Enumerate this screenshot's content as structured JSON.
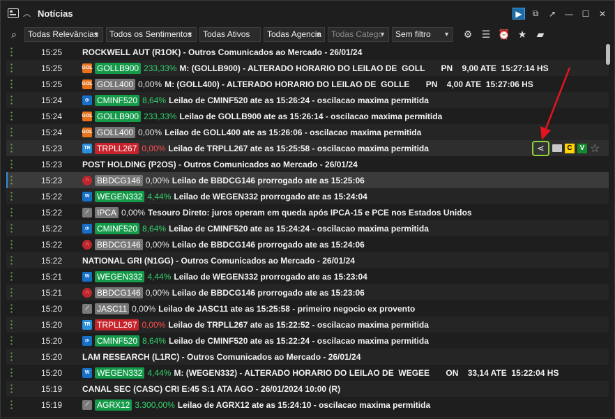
{
  "window": {
    "title": "Notícias"
  },
  "toolbar": {
    "relevance": "Todas Relevâncias",
    "sentiment": "Todos os Sentimentos",
    "assets": "Todas Ativos",
    "agency": "Todas Agencia",
    "category": "Todas Catego",
    "filter": "Sem filtro"
  },
  "row_actions": {
    "c_label": "C",
    "v_label": "V"
  },
  "rows": [
    {
      "time": "15:25",
      "text": "ROCKWELL AUT (R1OK) - Outros Comunicados ao Mercado - 26/01/24"
    },
    {
      "time": "15:25",
      "ticker": "GOLLB900",
      "pct": "233,33%",
      "text": "M: (GOLLB900) - ALTERADO HORARIO DO LEILAO DE  GOLL       PN    9,00 ATE  15:27:14 HS"
    },
    {
      "time": "15:25",
      "ticker": "GOLL400",
      "pct": "0,00%",
      "text": "M: (GOLL400) - ALTERADO HORARIO DO LEILAO DE  GOLLE       PN    4,00 ATE  15:27:06 HS"
    },
    {
      "time": "15:24",
      "ticker": "CMINF520",
      "pct": "8,64%",
      "text": "Leilao de CMINF520 ate as 15:26:24 - oscilacao maxima permitida"
    },
    {
      "time": "15:24",
      "ticker": "GOLLB900",
      "pct": "233,33%",
      "text": "Leilao de GOLLB900 ate as 15:26:14 - oscilacao maxima permitida"
    },
    {
      "time": "15:24",
      "ticker": "GOLL400",
      "pct": "0,00%",
      "text": "Leilao de GOLL400 ate as 15:26:06 - oscilacao maxima permitida"
    },
    {
      "time": "15:23",
      "ticker": "TRPLL267",
      "pct": "0,00%",
      "text": "Leilao de TRPLL267 ate as 15:25:58 - oscilacao maxima permitida"
    },
    {
      "time": "15:23",
      "text": "POST HOLDING (P2OS) - Outros Comunicados ao Mercado - 26/01/24"
    },
    {
      "time": "15:23",
      "ticker": "BBDCG146",
      "pct": "0,00%",
      "text": "Leilao de BBDCG146 prorrogado ate as 15:25:06"
    },
    {
      "time": "15:22",
      "ticker": "WEGEN332",
      "pct": "4,44%",
      "text": "Leilao de WEGEN332 prorrogado ate as 15:24:04"
    },
    {
      "time": "15:22",
      "ticker": "IPCA",
      "pct": "0,00%",
      "text": "Tesouro Direto: juros operam em queda após IPCA-15 e PCE nos Estados Unidos"
    },
    {
      "time": "15:22",
      "ticker": "CMINF520",
      "pct": "8,64%",
      "text": "Leilao de CMINF520 ate as 15:24:24 - oscilacao maxima permitida"
    },
    {
      "time": "15:22",
      "ticker": "BBDCG146",
      "pct": "0,00%",
      "text": "Leilao de BBDCG146 prorrogado ate as 15:24:06"
    },
    {
      "time": "15:22",
      "text": "NATIONAL GRI (N1GG) - Outros Comunicados ao Mercado - 26/01/24"
    },
    {
      "time": "15:21",
      "ticker": "WEGEN332",
      "pct": "4,44%",
      "text": "Leilao de WEGEN332 prorrogado ate as 15:23:04"
    },
    {
      "time": "15:21",
      "ticker": "BBDCG146",
      "pct": "0,00%",
      "text": "Leilao de BBDCG146 prorrogado ate as 15:23:06"
    },
    {
      "time": "15:20",
      "ticker": "JASC11",
      "pct": "0,00%",
      "text": "Leilao de JASC11 ate as 15:25:58 - primeiro negocio ex provento"
    },
    {
      "time": "15:20",
      "ticker": "TRPLL267",
      "pct": "0,00%",
      "text": "Leilao de TRPLL267 ate as 15:22:52 - oscilacao maxima permitida"
    },
    {
      "time": "15:20",
      "ticker": "CMINF520",
      "pct": "8,64%",
      "text": "Leilao de CMINF520 ate as 15:22:24 - oscilacao maxima permitida"
    },
    {
      "time": "15:20",
      "text": "LAM RESEARCH (L1RC) - Outros Comunicados ao Mercado - 26/01/24"
    },
    {
      "time": "15:20",
      "ticker": "WEGEN332",
      "pct": "4,44%",
      "text": "M: (WEGEN332) - ALTERADO HORARIO DO LEILAO DE  WEGEE       ON    33,14 ATE  15:22:04 HS"
    },
    {
      "time": "15:19",
      "text": "CANAL SEC (CASC) CRI E:45 S:1 ATA AGO - 26/01/2024 10:00 (R)"
    },
    {
      "time": "15:19",
      "ticker": "AGRX12",
      "pct": "3.300,00%",
      "text": "Leilao de AGRX12 ate as 15:24:10 - oscilacao maxima permitida"
    }
  ]
}
